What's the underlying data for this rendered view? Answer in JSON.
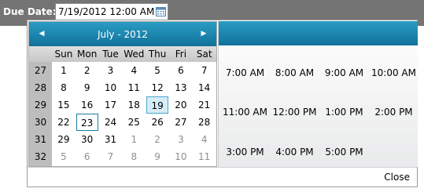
{
  "form": {
    "label": "Due Date:",
    "value": "7/19/2012 12:00 AM",
    "calendar_icon": "calendar-icon"
  },
  "calendar": {
    "title": "July - 2012",
    "prev_icon": "left-triangle-icon",
    "next_icon": "right-triangle-icon",
    "day_headers": [
      "Sun",
      "Mon",
      "Tue",
      "Wed",
      "Thu",
      "Fri",
      "Sat"
    ],
    "weeks": [
      {
        "week": "27",
        "days": [
          "1",
          "2",
          "3",
          "4",
          "5",
          "6",
          "7"
        ]
      },
      {
        "week": "28",
        "days": [
          "8",
          "9",
          "10",
          "11",
          "12",
          "13",
          "14"
        ]
      },
      {
        "week": "29",
        "days": [
          "15",
          "16",
          "17",
          "18",
          "19",
          "20",
          "21"
        ]
      },
      {
        "week": "30",
        "days": [
          "22",
          "23",
          "24",
          "25",
          "26",
          "27",
          "28"
        ]
      },
      {
        "week": "31",
        "days": [
          "29",
          "30",
          "31",
          "1",
          "2",
          "3",
          "4"
        ]
      },
      {
        "week": "32",
        "days": [
          "5",
          "6",
          "7",
          "8",
          "9",
          "10",
          "11"
        ]
      }
    ],
    "selected_day": "19",
    "today_day": "23"
  },
  "time": {
    "slots": [
      "7:00 AM",
      "8:00 AM",
      "9:00 AM",
      "10:00 AM",
      "11:00 AM",
      "12:00 PM",
      "1:00 PM",
      "2:00 PM",
      "3:00 PM",
      "4:00 PM",
      "5:00 PM"
    ]
  },
  "footer": {
    "close_label": "Close"
  },
  "colors": {
    "header_accent": "#1a86b2",
    "selected_fill": "#d6ecf6",
    "topbar": "#747474"
  }
}
